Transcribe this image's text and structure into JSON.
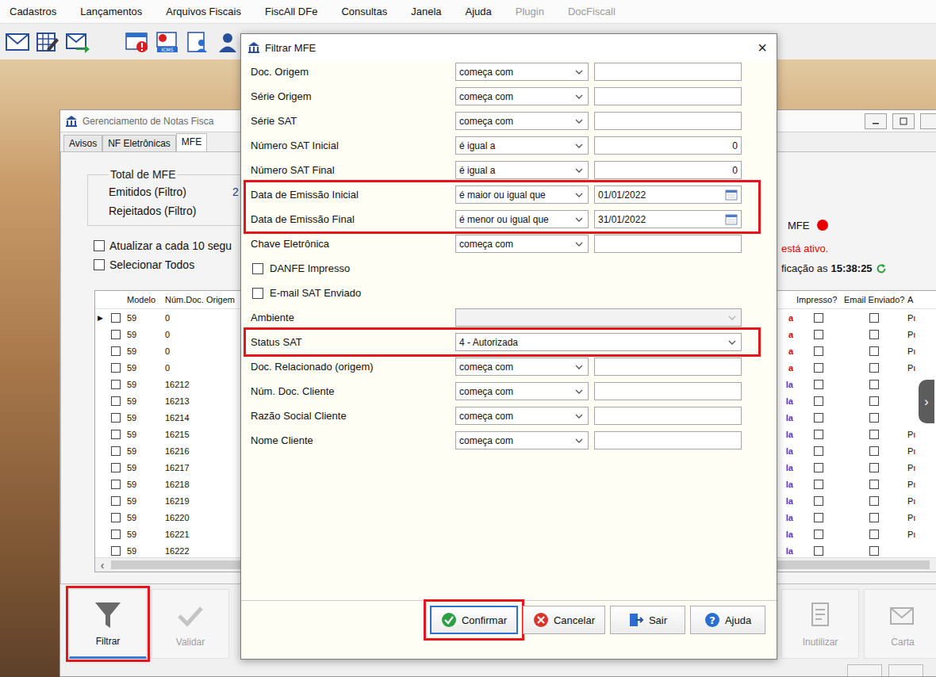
{
  "menu": [
    {
      "label": "Cadastros",
      "disabled": false
    },
    {
      "label": "Lançamentos",
      "disabled": false
    },
    {
      "label": "Arquivos Fiscais",
      "disabled": false
    },
    {
      "label": "FiscAll DFe",
      "disabled": false
    },
    {
      "label": "Consultas",
      "disabled": false
    },
    {
      "label": "Janela",
      "disabled": false
    },
    {
      "label": "Ajuda",
      "disabled": false
    },
    {
      "label": "Plugin",
      "disabled": true
    },
    {
      "label": "DocFiscall",
      "disabled": true
    }
  ],
  "toolbar": {
    "badge": "ICMS"
  },
  "background_window": {
    "title": "Gerenciamento de Notas Fisca",
    "tabs": [
      {
        "label": "Avisos",
        "selected": false
      },
      {
        "label": "NF Eletrônicas",
        "selected": false
      },
      {
        "label": "MFE",
        "selected": true
      }
    ],
    "summary": {
      "title": "Total de MFE",
      "rows": [
        {
          "label": "Emitidos (Filtro)",
          "value": "2"
        },
        {
          "label": "Rejeitados (Filtro)",
          "value": ""
        }
      ]
    },
    "options": [
      {
        "label": "Atualizar a cada 10 segu",
        "checked": false
      },
      {
        "label": "Selecionar Todos",
        "checked": false
      }
    ],
    "service": {
      "label": "MFE",
      "color": "#e60000",
      "message": "está ativo.",
      "check_prefix": "ficação as",
      "check_time": "15:38:25"
    },
    "table": {
      "left_columns": [
        "Modelo",
        "Núm.Doc. Origem"
      ],
      "right_columns": [
        "Impresso?",
        "Email Enviado?",
        "A"
      ],
      "current_marker": "▶",
      "scroll_left": "‹",
      "scroll_right": "›",
      "side_handle": "›",
      "rows": [
        {
          "model": "59",
          "doc": "0",
          "status": "a",
          "color": "#d00000",
          "printed": false,
          "emailed": false,
          "extra": "Pı",
          "current": true,
          "selected": false
        },
        {
          "model": "59",
          "doc": "0",
          "status": "a",
          "color": "#d00000",
          "printed": false,
          "emailed": false,
          "extra": "Pı",
          "current": false,
          "selected": false
        },
        {
          "model": "59",
          "doc": "0",
          "status": "a",
          "color": "#d00000",
          "printed": false,
          "emailed": false,
          "extra": "Pı",
          "current": false,
          "selected": false
        },
        {
          "model": "59",
          "doc": "0",
          "status": "a",
          "color": "#d00000",
          "printed": false,
          "emailed": false,
          "extra": "Pı",
          "current": false,
          "selected": false
        },
        {
          "model": "59",
          "doc": "16212",
          "status": "la",
          "color": "#5b35c9",
          "printed": false,
          "emailed": false,
          "extra": "",
          "current": false,
          "selected": false
        },
        {
          "model": "59",
          "doc": "16213",
          "status": "la",
          "color": "#5b35c9",
          "printed": false,
          "emailed": false,
          "extra": "",
          "current": false,
          "selected": false
        },
        {
          "model": "59",
          "doc": "16214",
          "status": "la",
          "color": "#5b35c9",
          "printed": false,
          "emailed": false,
          "extra": "",
          "current": false,
          "selected": false
        },
        {
          "model": "59",
          "doc": "16215",
          "status": "la",
          "color": "#5b35c9",
          "printed": false,
          "emailed": false,
          "extra": "Pı",
          "current": false,
          "selected": false
        },
        {
          "model": "59",
          "doc": "16216",
          "status": "la",
          "color": "#5b35c9",
          "printed": false,
          "emailed": false,
          "extra": "Pı",
          "current": false,
          "selected": false
        },
        {
          "model": "59",
          "doc": "16217",
          "status": "la",
          "color": "#5b35c9",
          "printed": false,
          "emailed": false,
          "extra": "Pı",
          "current": false,
          "selected": false
        },
        {
          "model": "59",
          "doc": "16218",
          "status": "la",
          "color": "#5b35c9",
          "printed": false,
          "emailed": false,
          "extra": "Pı",
          "current": false,
          "selected": false
        },
        {
          "model": "59",
          "doc": "16219",
          "status": "la",
          "color": "#5b35c9",
          "printed": false,
          "emailed": false,
          "extra": "Pı",
          "current": false,
          "selected": false
        },
        {
          "model": "59",
          "doc": "16220",
          "status": "la",
          "color": "#5b35c9",
          "printed": false,
          "emailed": false,
          "extra": "Pı",
          "current": false,
          "selected": false
        },
        {
          "model": "59",
          "doc": "16221",
          "status": "la",
          "color": "#5b35c9",
          "printed": false,
          "emailed": false,
          "extra": "Pı",
          "current": false,
          "selected": false
        },
        {
          "model": "59",
          "doc": "16222",
          "status": "la",
          "color": "#5b35c9",
          "printed": false,
          "emailed": false,
          "extra": "",
          "current": false,
          "selected": false
        }
      ]
    },
    "left_buttons": [
      {
        "label": "Filtrar",
        "disabled": false,
        "focused": true,
        "highlighted": true
      },
      {
        "label": "Validar",
        "disabled": true,
        "focused": false,
        "highlighted": false
      }
    ],
    "right_buttons": [
      {
        "label": "Inutilizar",
        "disabled": true,
        "focused": false,
        "highlighted": false
      },
      {
        "label": "Carta",
        "disabled": true,
        "focused": false,
        "highlighted": false
      }
    ]
  },
  "dialog": {
    "title": "Filtrar MFE",
    "close": "×",
    "help_glyph": "?",
    "fields": [
      {
        "kind": "text",
        "label": "Doc. Origem",
        "operator": "começa com",
        "value": "",
        "highlighted": false
      },
      {
        "kind": "text",
        "label": "Série Origem",
        "operator": "começa com",
        "value": "",
        "highlighted": false
      },
      {
        "kind": "text",
        "label": "Série SAT",
        "operator": "começa com",
        "value": "",
        "highlighted": false
      },
      {
        "kind": "number",
        "label": "Número SAT Inicial",
        "operator": "é igual a",
        "value": "0",
        "highlighted": false
      },
      {
        "kind": "number",
        "label": "Número SAT Final",
        "operator": "é igual a",
        "value": "0",
        "highlighted": false
      },
      {
        "kind": "date",
        "label": "Data de Emissão Inicial",
        "operator": "é maior ou igual que",
        "value": "01/01/2022",
        "highlighted": true
      },
      {
        "kind": "date",
        "label": "Data de Emissão Final",
        "operator": "é menor ou igual que",
        "value": "31/01/2022",
        "highlighted": true
      },
      {
        "kind": "text",
        "label": "Chave Eletrônica",
        "operator": "começa com",
        "value": "",
        "highlighted": false
      },
      {
        "kind": "check",
        "label": "DANFE Impresso",
        "checked": false,
        "highlighted": false
      },
      {
        "kind": "check",
        "label": "E-mail SAT Enviado",
        "checked": false,
        "highlighted": false
      },
      {
        "kind": "select",
        "label": "Ambiente",
        "value": "",
        "disabled": true,
        "highlighted": false
      },
      {
        "kind": "select",
        "label": "Status SAT",
        "value": "4 - Autorizada",
        "disabled": false,
        "highlighted": true
      },
      {
        "kind": "text",
        "label": "Doc. Relacionado (origem)",
        "operator": "começa com",
        "value": "",
        "highlighted": false
      },
      {
        "kind": "text",
        "label": "Núm. Doc. Cliente",
        "operator": "começa com",
        "value": "",
        "highlighted": false
      },
      {
        "kind": "text",
        "label": "Razão Social Cliente",
        "operator": "começa com",
        "value": "",
        "highlighted": false
      },
      {
        "kind": "text",
        "label": "Nome Cliente",
        "operator": "começa com",
        "value": "",
        "highlighted": false
      }
    ],
    "buttons": [
      {
        "label": "Confirmar",
        "focused": true,
        "highlighted": true
      },
      {
        "label": "Cancelar",
        "focused": false,
        "highlighted": false
      },
      {
        "label": "Sair",
        "focused": false,
        "highlighted": false
      },
      {
        "label": "Ajuda",
        "focused": false,
        "highlighted": false
      }
    ]
  }
}
